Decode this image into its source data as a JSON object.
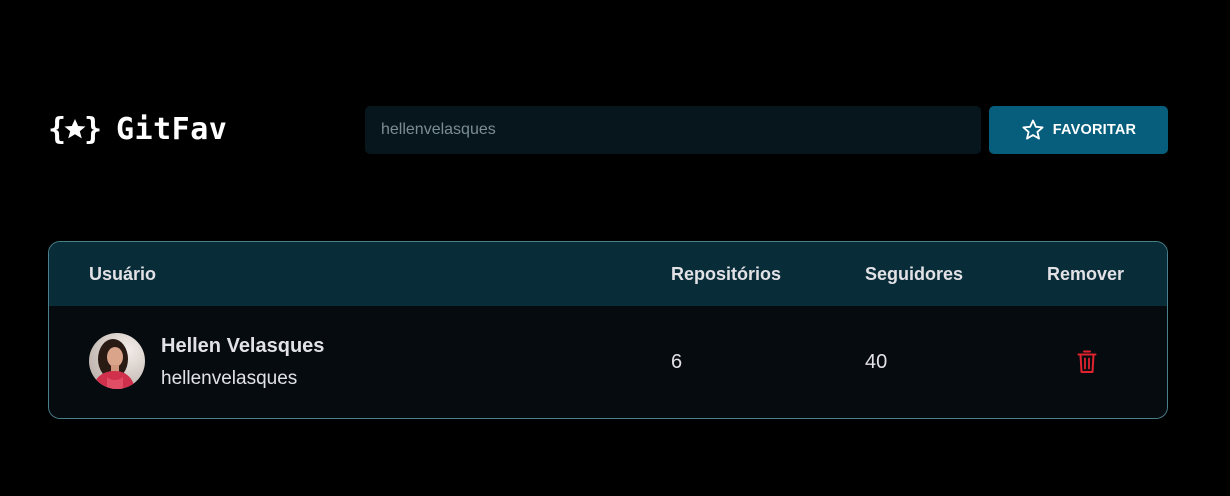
{
  "header": {
    "logo_text": "GitFav",
    "search": {
      "value": "",
      "placeholder": "hellenvelasques"
    },
    "favorite_button_label": "FAVORITAR"
  },
  "table": {
    "columns": [
      "Usuário",
      "Repositórios",
      "Seguidores",
      "Remover"
    ],
    "rows": [
      {
        "name": "Hellen Velasques",
        "login": "hellenvelasques",
        "repositories": "6",
        "followers": "40"
      }
    ]
  },
  "colors": {
    "background": "#000000",
    "accent": "#065e7c",
    "table_header": "#092d38",
    "remove": "#f75a68"
  }
}
